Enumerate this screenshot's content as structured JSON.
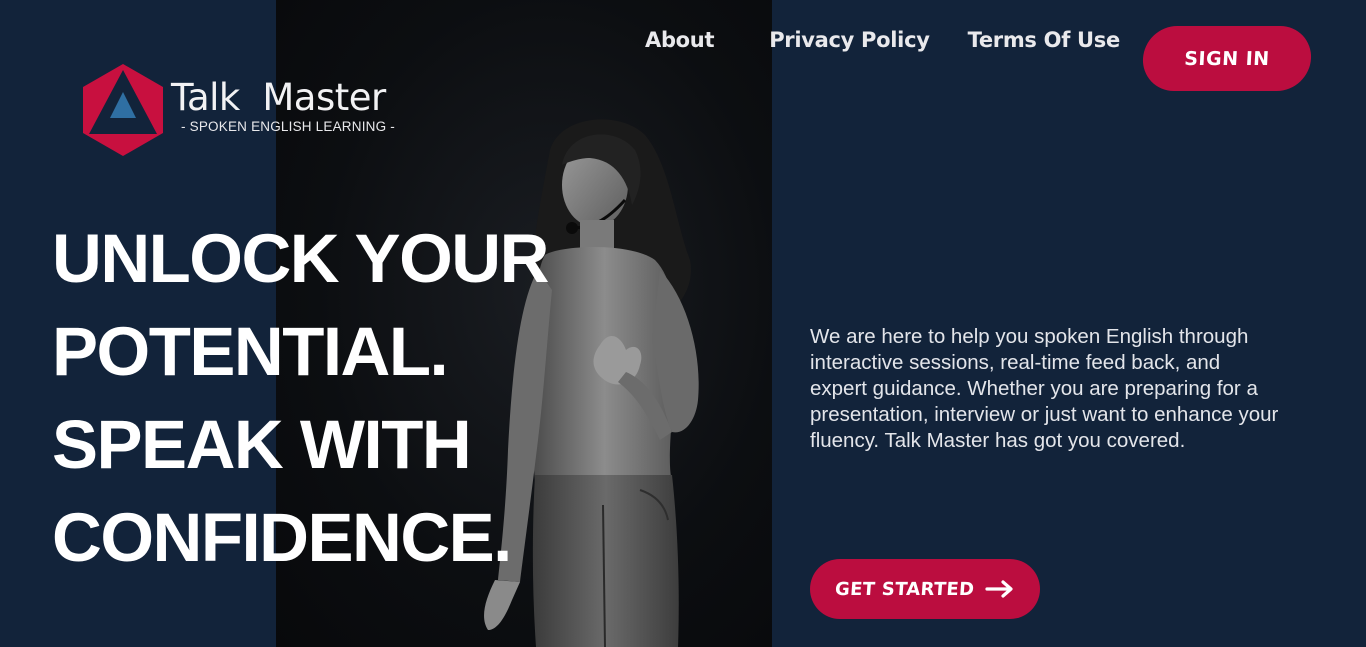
{
  "nav": {
    "about": "About",
    "privacy": "Privacy Policy",
    "terms": "Terms Of Use",
    "sign_in": "SIGN IN"
  },
  "logo": {
    "name": "Talk  Master",
    "tagline": "- SPOKEN ENGLISH LEARNING -"
  },
  "hero": {
    "headline_lines": [
      "UNLOCK YOUR",
      "POTENTIAL.",
      "SPEAK WITH",
      "CONFIDENCE."
    ],
    "description": "We are here to help you spoken English through interactive sessions, real-time feed back, and expert guidance. Whether you are preparing for a presentation, interview or just want to enhance your fluency. Talk Master has got you covered.",
    "cta_label": "GET STARTED"
  },
  "icons": {
    "logo": "triangle-logo-icon",
    "cta_arrow": "arrow-right-icon"
  },
  "colors": {
    "background": "#12233a",
    "photo_panel": "#0c0e11",
    "accent": "#bb0d3f",
    "text": "#ffffff"
  }
}
